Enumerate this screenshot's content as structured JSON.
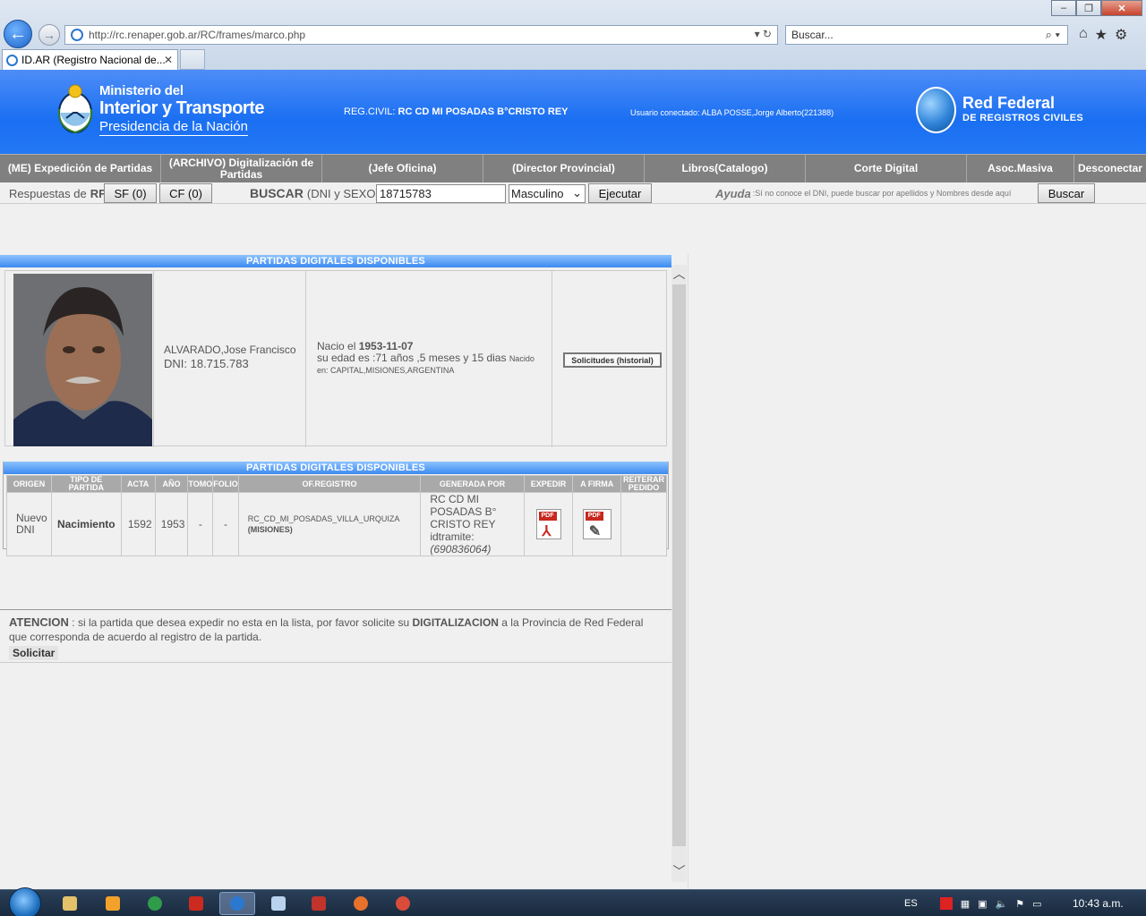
{
  "browser": {
    "url": "http://rc.renaper.gob.ar/RC/frames/marco.php",
    "search_placeholder": "Buscar...",
    "tab_title": "ID.AR (Registro Nacional de..."
  },
  "header": {
    "ministerio_l1": "Ministerio del",
    "ministerio_l2": "Interior y Transporte",
    "ministerio_l3": "Presidencia de la Nación",
    "regcivil_label": "REG.CIVIL:",
    "regcivil_value": "RC CD MI POSADAS B°CRISTO REY",
    "usuario": "Usuario conectado: ALBA POSSE,Jorge Alberto(221388)",
    "redfed_l1": "Red Federal",
    "redfed_l2": "DE REGISTROS CIVILES"
  },
  "menu": {
    "items": [
      "(ME) Expedición de Partidas",
      "(ARCHIVO) Digitalización de Partidas",
      "(Jefe Oficina)",
      "(Director Provincial)",
      "Libros(Catalogo)",
      "Corte Digital",
      "Asoc.Masiva",
      "Desconectar"
    ]
  },
  "searchbar": {
    "respuestas_label": "Respuestas de",
    "respuestas_rf": "RF",
    "sf_button": "SF (0)",
    "cf_button": "CF (0)",
    "buscar_label": "BUSCAR",
    "buscar_hint": "(DNI y SEXO)",
    "dni_value": "18715783",
    "sexo_value": "Masculino",
    "ejecutar_button": "Ejecutar",
    "ayuda_label": "Ayuda",
    "ayuda_text": ":Sí no conoce el DNI, puede buscar por apellidos y Nombres desde aquí",
    "buscar_button": "Buscar"
  },
  "person": {
    "section_title": "PARTIDAS DIGITALES DISPONIBLES",
    "name": "ALVARADO,Jose Francisco",
    "dni": "DNI: 18.715.783",
    "birth_prefix": "Nacio el",
    "birth_date": "1953-11-07",
    "age": "su edad es :71 años ,5 meses y 15 dias",
    "born_label": "Nacido",
    "born_place": "en: CAPITAL,MISIONES,ARGENTINA",
    "history_button": "Solicitudes (historial)"
  },
  "partidas": {
    "section_title": "PARTIDAS DIGITALES DISPONIBLES",
    "headers": [
      "ORIGEN",
      "TIPO DE PARTIDA",
      "ACTA",
      "AÑO",
      "TOMO",
      "FOLIO",
      "OF.REGISTRO",
      "GENERADA POR",
      "EXPEDIR",
      "A FIRMA",
      "REITERAR PEDIDO"
    ],
    "rows": [
      {
        "origen": "Nuevo DNI",
        "tipo": "Nacimiento",
        "acta": "1592",
        "anio": "1953",
        "tomo": "-",
        "folio": "-",
        "registro": "RC_CD_MI_POSADAS_VILLA_URQUIZA",
        "registro_prov": "(MISIONES)",
        "generada": "RC CD MI POSADAS B° CRISTO REY",
        "idtramite_label": "idtramite:",
        "idtramite": "(690836064)"
      }
    ]
  },
  "atencion": {
    "label": "ATENCION",
    "text1": ": si la partida que desea expedir no esta en la lista, por favor solicite su",
    "highlight": "DIGITALIZACION",
    "text2": "a la Provincia de Red Federal que corresponda de acuerdo al registro de la partida.",
    "button": "Solicitar"
  },
  "taskbar": {
    "lang": "ES",
    "clock": "10:43 a.m."
  }
}
